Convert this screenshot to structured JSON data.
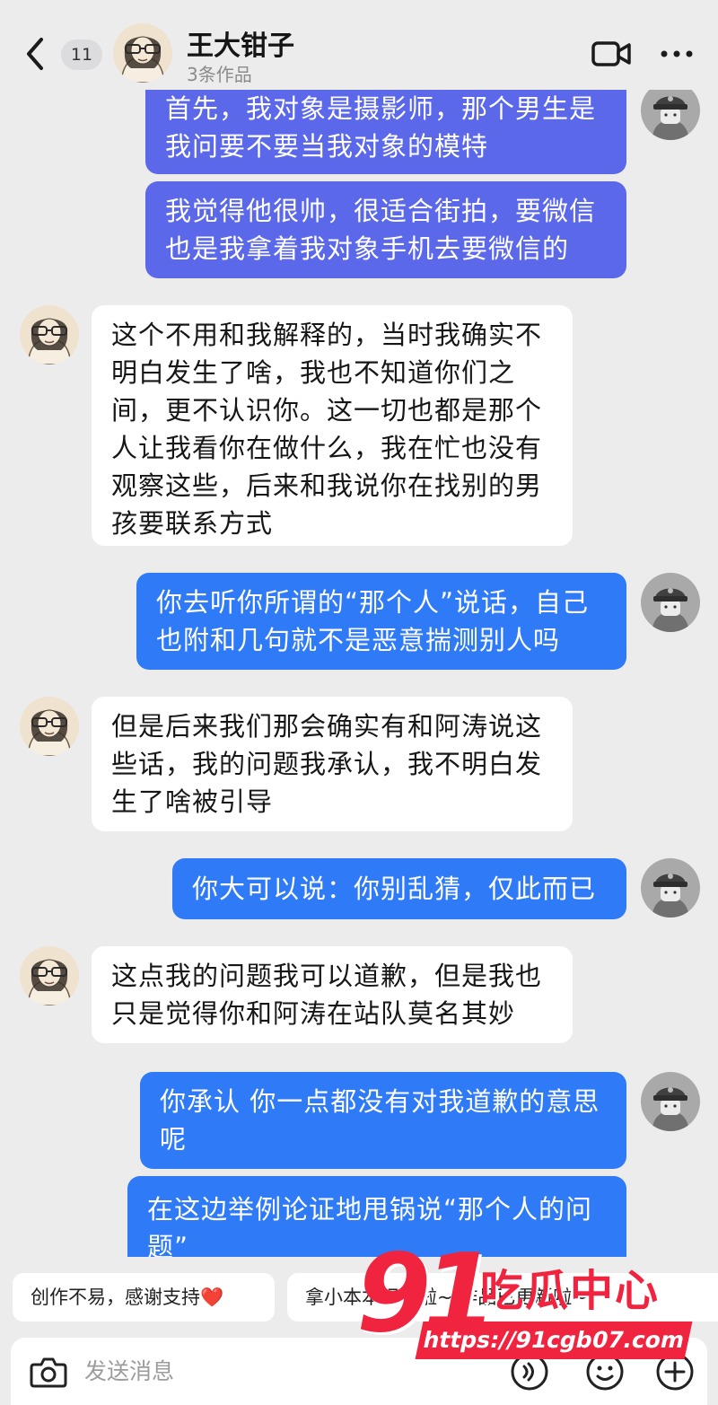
{
  "header": {
    "unread_count": "11",
    "contact_name": "王大钳子",
    "contact_subtitle": "3条作品"
  },
  "messages": [
    {
      "sender": "me",
      "text": "首先，我对象是摄影师，那个男生是\n我问要不要当我对象的模特"
    },
    {
      "sender": "me",
      "text": "我觉得他很帅，很适合街拍，要微信\n也是我拿着我对象手机去要微信的"
    },
    {
      "sender": "other",
      "text": "这个不用和我解释的，当时我确实不\n明白发生了啥，我也不知道你们之\n间，更不认识你。这一切也都是那个\n人让我看你在做什么，我在忙也没有\n观察这些，后来和我说你在找别的男\n孩要联系方式"
    },
    {
      "sender": "me",
      "text": "你去听你所谓的“那个人”说话，自己\n也附和几句就不是恶意揣测别人吗"
    },
    {
      "sender": "other",
      "text": "但是后来我们那会确实有和阿涛说这\n些话，我的问题我承认，我不明白发\n生了啥被引导"
    },
    {
      "sender": "me",
      "text": "你大可以说：你别乱猜，仅此而已"
    },
    {
      "sender": "other",
      "text": "这点我的问题我可以道歉，但是我也\n只是觉得你和阿涛在站队莫名其妙"
    },
    {
      "sender": "me",
      "text": "你承认 你一点都没有对我道歉的意思\n呢"
    },
    {
      "sender": "me",
      "text": "在这边举例论证地甩锅说“那个人的问\n题”"
    }
  ],
  "quick_replies": [
    "创作不易，感谢支持❤️",
    "拿小本本记下啦~ 作品已更新啦~"
  ],
  "input": {
    "placeholder": "发送消息"
  },
  "watermark": {
    "brand": "91",
    "title": "吃瓜中心",
    "url": "https://91cgb07.com"
  },
  "colors": {
    "my_bubble": "#5b68ea",
    "my_bubble_alt": "#2f7af7",
    "other_bubble": "#ffffff",
    "background": "#ececed",
    "watermark": "#f0243f"
  }
}
